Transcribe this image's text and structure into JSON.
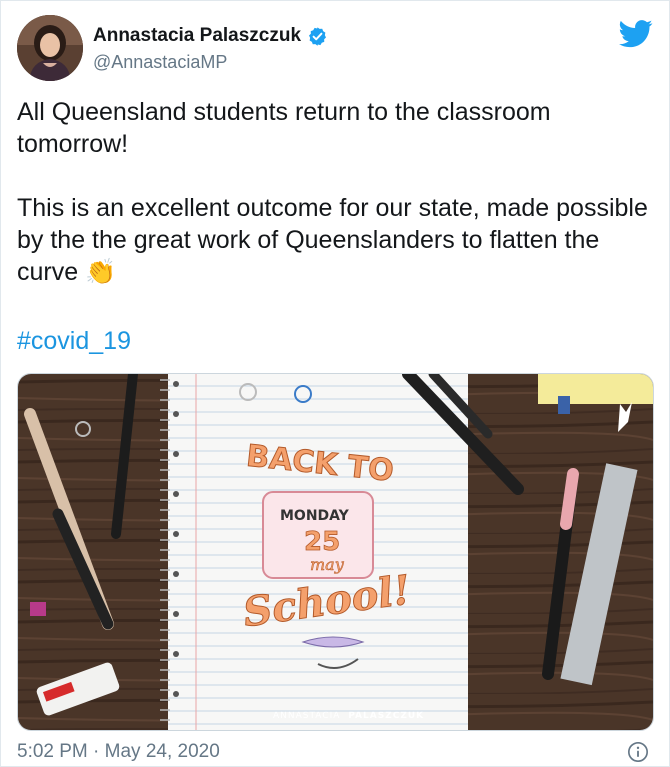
{
  "author": {
    "display_name": "Annastacia Palaszczuk",
    "handle": "@AnnastaciaMP"
  },
  "tweet": {
    "text": "All Queensland students return to the classroom tomorrow!\n\nThis is an excellent outcome for our state, made possible by the the great work of Queenslanders to flatten the curve 👏",
    "hashtag": "#covid_19",
    "timestamp": "5:02 PM · May 24, 2020"
  },
  "image": {
    "headline": "BACK TO",
    "day": "MONDAY",
    "date_number": "25",
    "month": "may",
    "footer": "School!",
    "watermark_first": "ANNASTACIA",
    "watermark_last": "PALASZCZUK"
  },
  "colors": {
    "brand": "#1da1f2",
    "hashtag": "#1b95e0",
    "verified": "#1da1f2",
    "wood": "#4a3528",
    "orange_lettering": "#f4a06c"
  },
  "icons": [
    "verified-icon",
    "twitter-bird-icon",
    "info-icon",
    "clap-emoji"
  ]
}
